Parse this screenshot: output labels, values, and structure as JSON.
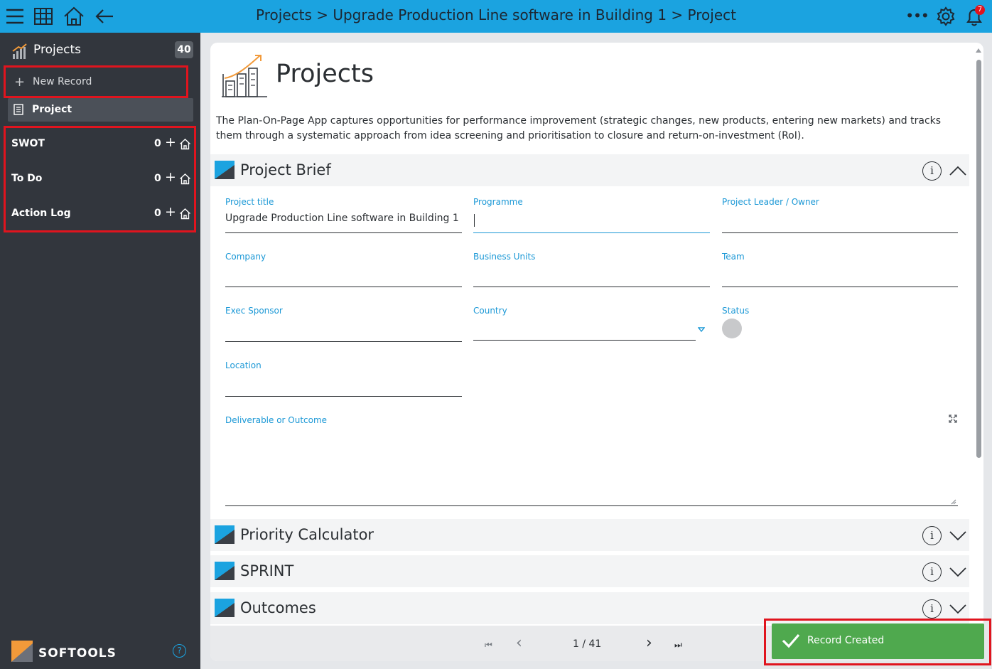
{
  "topbar": {
    "breadcrumb": "Projects > Upgrade Production Line software in Building 1 > Project",
    "notification_count": "7",
    "more_label": "•••"
  },
  "sidebar": {
    "app_title": "Projects",
    "record_count": "40",
    "new_record_label": "New Record",
    "current_view": "Project",
    "groups": [
      {
        "name": "SWOT",
        "count": "0"
      },
      {
        "name": "To Do",
        "count": "0"
      },
      {
        "name": "Action Log",
        "count": "0"
      }
    ],
    "brand": "SOFTOOLS",
    "help_label": "?"
  },
  "main": {
    "title": "Projects",
    "description": "The Plan-On-Page App captures opportunities for performance improvement (strategic changes, new products, entering new markets) and tracks them through a systematic approach from idea screening and prioritisation to closure and return-on-investment (RoI).",
    "sections": [
      {
        "title": "Project Brief",
        "expanded": true
      },
      {
        "title": "Priority Calculator",
        "expanded": false
      },
      {
        "title": "SPRINT",
        "expanded": false
      },
      {
        "title": "Outcomes",
        "expanded": false
      }
    ],
    "fields": {
      "project_title": {
        "label": "Project title",
        "value": "Upgrade Production Line software in Building 1"
      },
      "programme": {
        "label": "Programme",
        "value": ""
      },
      "project_leader": {
        "label": "Project Leader / Owner",
        "value": ""
      },
      "company": {
        "label": "Company",
        "value": ""
      },
      "business_units": {
        "label": "Business Units",
        "value": ""
      },
      "team": {
        "label": "Team",
        "value": ""
      },
      "exec_sponsor": {
        "label": "Exec Sponsor",
        "value": ""
      },
      "country": {
        "label": "Country",
        "value": ""
      },
      "status": {
        "label": "Status",
        "value": ""
      },
      "location": {
        "label": "Location",
        "value": ""
      },
      "deliverable": {
        "label": "Deliverable or Outcome",
        "value": ""
      }
    },
    "info_label": "i"
  },
  "pager": {
    "position": "1 / 41",
    "first": "⏮",
    "prev": "‹",
    "next": "›",
    "last": "⏭"
  },
  "toast": {
    "message": "Record Created"
  },
  "colors": {
    "topbar": "#1ba3e0",
    "sidebar": "#32363d",
    "accent_label": "#1b98d6",
    "toast": "#4fa94e",
    "highlight": "#e0141e"
  }
}
